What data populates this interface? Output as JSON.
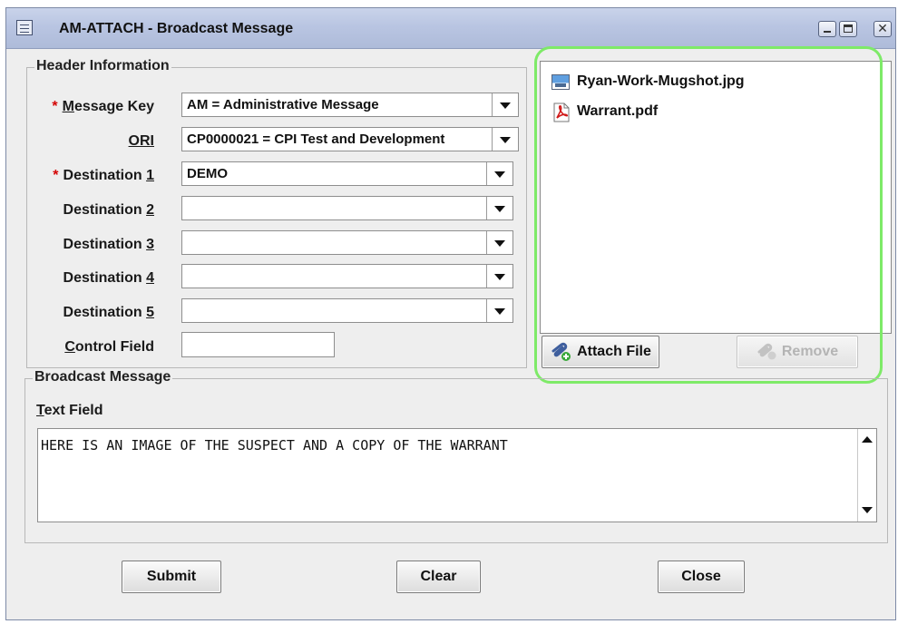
{
  "window": {
    "title": "AM-ATTACH - Broadcast Message"
  },
  "header_info": {
    "legend": "Header Information",
    "required_marker": "*",
    "message_key": {
      "label_pre": "",
      "label_mn": "M",
      "label_post": "essage Key",
      "value": "AM = Administrative Message"
    },
    "ori": {
      "label_pre": "",
      "label_mn": "ORI",
      "label_post": "",
      "value": "CP0000021 = CPI Test and Development"
    },
    "destination_1": {
      "label_pre": "Destination ",
      "label_mn": "1",
      "label_post": "",
      "value": "DEMO"
    },
    "destination_2": {
      "label_pre": "Destination ",
      "label_mn": "2",
      "label_post": "",
      "value": ""
    },
    "destination_3": {
      "label_pre": "Destination ",
      "label_mn": "3",
      "label_post": "",
      "value": ""
    },
    "destination_4": {
      "label_pre": "Destination ",
      "label_mn": "4",
      "label_post": "",
      "value": ""
    },
    "destination_5": {
      "label_pre": "Destination ",
      "label_mn": "5",
      "label_post": "",
      "value": ""
    },
    "control_field": {
      "label_pre": "",
      "label_mn": "C",
      "label_post": "ontrol Field",
      "value": ""
    }
  },
  "attachments": {
    "files": [
      {
        "name": "Ryan-Work-Mugshot.jpg",
        "icon": "image-file-icon"
      },
      {
        "name": "Warrant.pdf",
        "icon": "pdf-file-icon"
      }
    ],
    "attach_button": "Attach File",
    "remove_button": "Remove",
    "highlight_color": "#7eea68"
  },
  "broadcast": {
    "legend": "Broadcast Message",
    "text_field_label_mn": "T",
    "text_field_label_post": "ext Field",
    "message": "HERE IS AN IMAGE OF THE SUSPECT AND A COPY OF THE WARRANT"
  },
  "buttons": {
    "submit": "Submit",
    "clear": "Clear",
    "close": "Close"
  },
  "colors": {
    "required": "#d40000",
    "titlebar": "#b9c5e2"
  }
}
